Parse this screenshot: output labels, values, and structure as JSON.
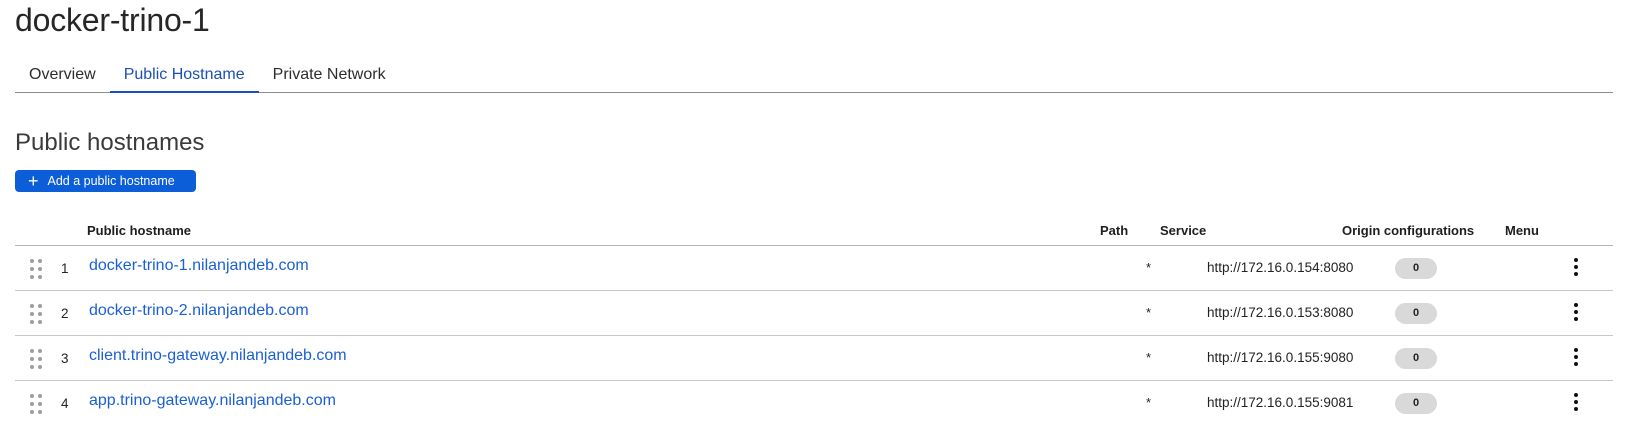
{
  "page": {
    "title": "docker-trino-1"
  },
  "tabs": [
    {
      "label": "Overview",
      "active": false
    },
    {
      "label": "Public Hostname",
      "active": true
    },
    {
      "label": "Private Network",
      "active": false
    }
  ],
  "section": {
    "title": "Public hostnames",
    "add_button_label": "Add a public hostname"
  },
  "table": {
    "headers": {
      "hostname": "Public hostname",
      "path": "Path",
      "service": "Service",
      "origin": "Origin configurations",
      "menu": "Menu"
    },
    "rows": [
      {
        "index": "1",
        "hostname": "docker-trino-1.nilanjandeb.com",
        "path": "*",
        "service": "http://172.16.0.154:8080",
        "origin_count": "0"
      },
      {
        "index": "2",
        "hostname": "docker-trino-2.nilanjandeb.com",
        "path": "*",
        "service": "http://172.16.0.153:8080",
        "origin_count": "0"
      },
      {
        "index": "3",
        "hostname": "client.trino-gateway.nilanjandeb.com",
        "path": "*",
        "service": "http://172.16.0.155:9080",
        "origin_count": "0"
      },
      {
        "index": "4",
        "hostname": "app.trino-gateway.nilanjandeb.com",
        "path": "*",
        "service": "http://172.16.0.155:9081",
        "origin_count": "0"
      }
    ]
  },
  "icons": {
    "add": "plus-icon",
    "drag": "drag-handle-icon",
    "menu": "kebab-menu-icon"
  },
  "colors": {
    "accent": "#0b5ed7",
    "link": "#1a5fd6",
    "active_tab": "#1a4fb8",
    "badge_bg": "#d9d9d9"
  }
}
